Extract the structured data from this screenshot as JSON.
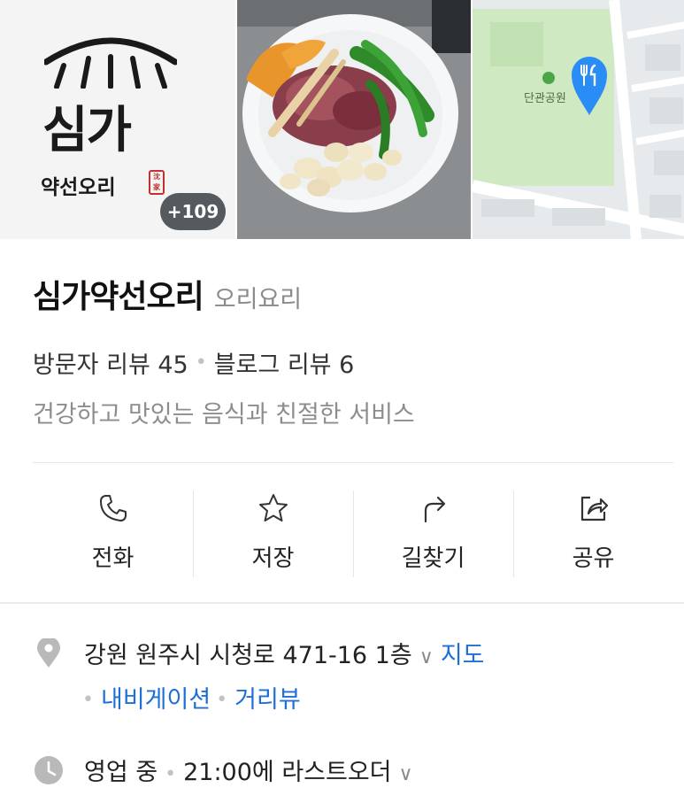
{
  "photos": {
    "logo": {
      "name_main": "심가",
      "name_sub": "약선오리",
      "stamp": "沈家"
    },
    "count_badge": "+109",
    "map": {
      "park_label": "단관공원",
      "pin_color": "#2a8df5"
    }
  },
  "place": {
    "name": "심가약선오리",
    "category": "오리요리",
    "visitor_reviews": "방문자 리뷰 45",
    "blog_reviews": "블로그 리뷰 6",
    "description": "건강하고 맛있는 음식과 친절한 서비스"
  },
  "actions": [
    {
      "label": "전화",
      "icon": "phone-icon"
    },
    {
      "label": "저장",
      "icon": "star-icon"
    },
    {
      "label": "길찾기",
      "icon": "directions-icon"
    },
    {
      "label": "공유",
      "icon": "share-icon"
    }
  ],
  "info": {
    "address": "강원 원주시 시청로 471-16 1층",
    "map_link": "지도",
    "navigation_link": "내비게이션",
    "street_view_link": "거리뷰",
    "hours_status": "영업 중",
    "hours_detail": "21:00에 라스트오더"
  },
  "colors": {
    "link": "#1e6fd6",
    "muted": "#8d8d8d",
    "badge_bg": "#555a5e"
  }
}
